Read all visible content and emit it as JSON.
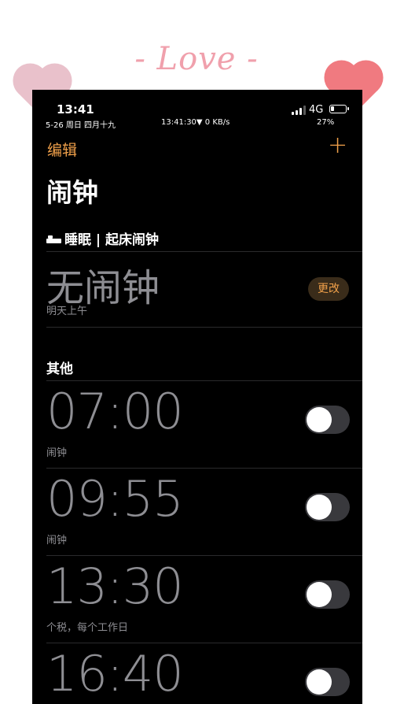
{
  "decor": {
    "love_text": "- Love -"
  },
  "status_bar": {
    "time": "13:41",
    "date": "5-26 周日 四月十九",
    "network_stats": "13:41:30▼ 0 KB/s",
    "network_type": "4G",
    "battery_percent": "27%",
    "battery_level": 0.27
  },
  "nav": {
    "edit_label": "编辑",
    "add_label": "+",
    "title": "闹钟"
  },
  "sleep_section": {
    "icon": "bed-icon",
    "header": "睡眠 | 起床闹钟",
    "no_alarm_text": "无闹钟",
    "subtitle": "明天上午",
    "change_label": "更改"
  },
  "other_section": {
    "header": "其他",
    "alarms": [
      {
        "time": "07:00",
        "label": "闹钟",
        "enabled": false
      },
      {
        "time": "09:55",
        "label": "闹钟",
        "enabled": false
      },
      {
        "time": "13:30",
        "label": "个税，每个工作日",
        "enabled": false
      },
      {
        "time": "16:40",
        "label": "",
        "enabled": false
      }
    ]
  },
  "colors": {
    "accent": "#f0a04a",
    "background": "#000000",
    "secondary_text": "#8e8e93",
    "toggle_off": "#39393d"
  }
}
